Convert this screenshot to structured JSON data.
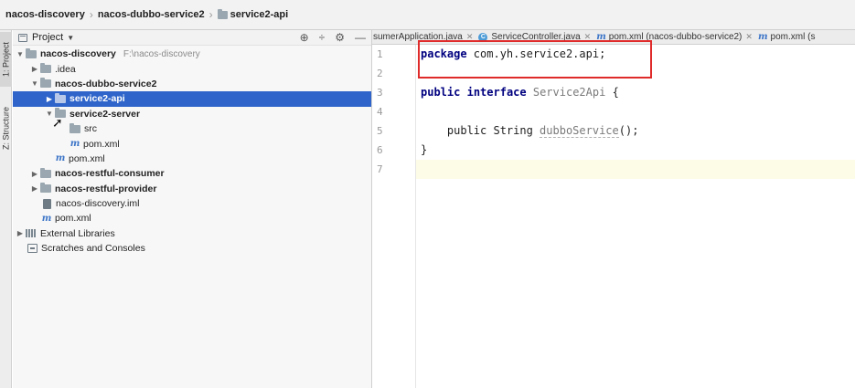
{
  "breadcrumb": {
    "items": [
      "nacos-discovery",
      "nacos-dubbo-service2",
      "service2-api"
    ]
  },
  "side_tabs": {
    "project": "1: Project",
    "structure": "Z: Structure"
  },
  "project_panel": {
    "title": "Project",
    "tools": [
      "⊕",
      "÷",
      "⚙",
      "—"
    ]
  },
  "tree": {
    "root_label": "nacos-discovery",
    "root_path": "F:\\nacos-discovery",
    "idea": ".idea",
    "dubbo_service2": "nacos-dubbo-service2",
    "service2_api": "service2-api",
    "service2_server": "service2-server",
    "src": "src",
    "server_pom": "pom.xml",
    "dubbo_pom": "pom.xml",
    "restful_consumer": "nacos-restful-consumer",
    "restful_provider": "nacos-restful-provider",
    "iml": "nacos-discovery.iml",
    "root_pom": "pom.xml",
    "external_libraries": "External Libraries",
    "scratches": "Scratches and Consoles"
  },
  "editor": {
    "tabs": [
      {
        "label": "sumerApplication.java",
        "icon": "none"
      },
      {
        "label": "ServiceController.java",
        "icon": "class-icon"
      },
      {
        "label": "pom.xml (nacos-dubbo-service2)",
        "icon": "maven-icon"
      },
      {
        "label": "pom.xml (s",
        "icon": "maven-icon"
      }
    ],
    "line_numbers": [
      "1",
      "2",
      "3",
      "4",
      "5",
      "6",
      "7"
    ],
    "code": {
      "package_kw": "package",
      "package_name": " com.yh.service2.api;",
      "public_kw": "public",
      "interface_kw": "interface",
      "interface_name": "Service2Api",
      "open_brace": " {",
      "method_indent_public": "    public",
      "method_return": " String ",
      "method_name": "dubboService",
      "method_tail": "();",
      "close_brace": "}"
    },
    "highlight_color": "#e02b2b"
  }
}
